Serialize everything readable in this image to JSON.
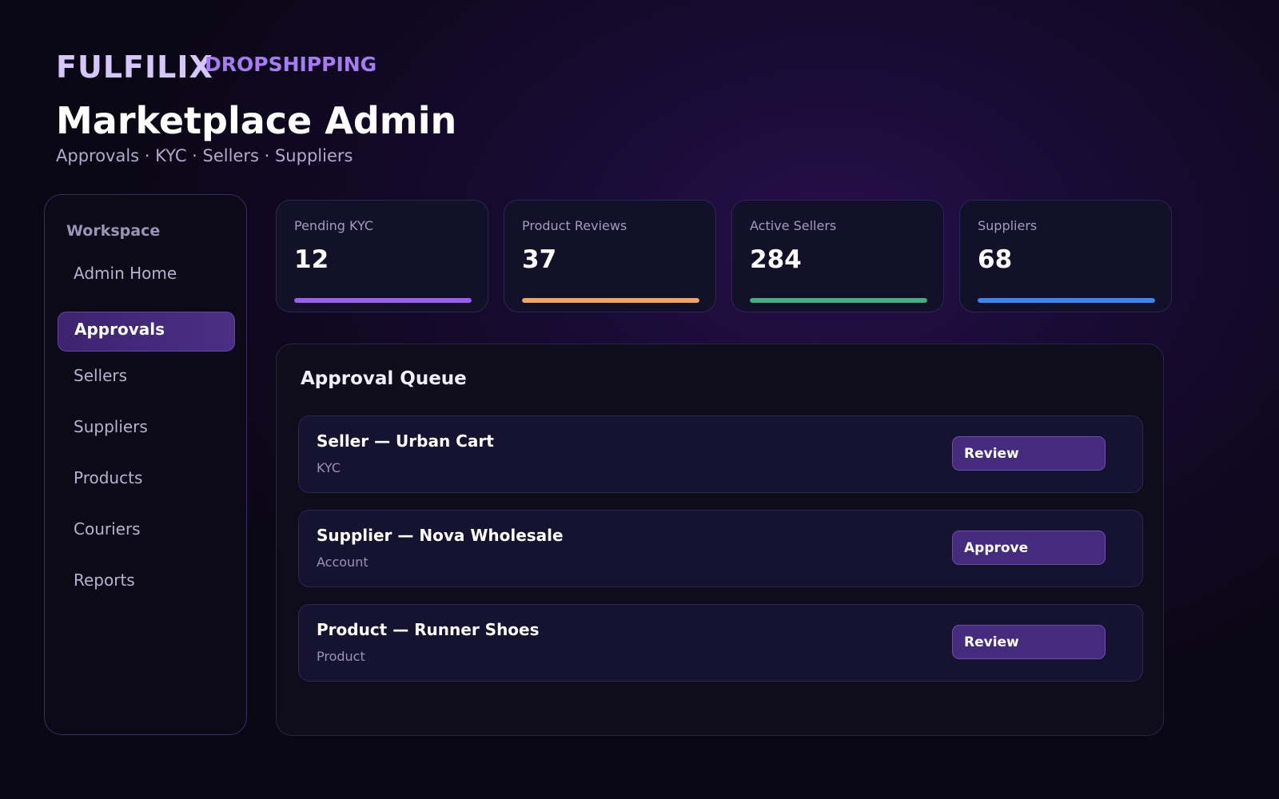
{
  "brand": {
    "name": "FULFILIX",
    "tagline": "DROPSHIPPING"
  },
  "header": {
    "title": "Marketplace Admin",
    "subtitle": "Approvals · KYC · Sellers · Suppliers"
  },
  "sidebar": {
    "heading": "Workspace",
    "items": [
      {
        "label": "Admin Home",
        "active": false
      },
      {
        "label": "Approvals",
        "active": true
      },
      {
        "label": "Sellers",
        "active": false
      },
      {
        "label": "Suppliers",
        "active": false
      },
      {
        "label": "Products",
        "active": false
      },
      {
        "label": "Couriers",
        "active": false
      },
      {
        "label": "Reports",
        "active": false
      }
    ]
  },
  "stats": [
    {
      "label": "Pending KYC",
      "value": "12",
      "bar_color": "#9d5cf2",
      "bar_fill": 1.0
    },
    {
      "label": "Product Reviews",
      "value": "37",
      "bar_color": "#f2a65a",
      "bar_fill": 1.0
    },
    {
      "label": "Active Sellers",
      "value": "284",
      "bar_color": "#3fb07e",
      "bar_fill": 1.0
    },
    {
      "label": "Suppliers",
      "value": "68",
      "bar_color": "#3d86f5",
      "bar_fill": 1.0
    }
  ],
  "queue": {
    "title": "Approval Queue",
    "items": [
      {
        "title": "Seller — Urban Cart",
        "tag": "KYC",
        "action": "Review"
      },
      {
        "title": "Supplier — Nova Wholesale",
        "tag": "Account",
        "action": "Approve"
      },
      {
        "title": "Product — Runner Shoes",
        "tag": "Product",
        "action": "Review"
      }
    ]
  }
}
